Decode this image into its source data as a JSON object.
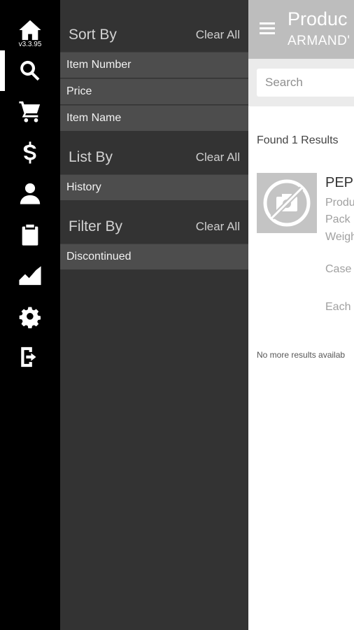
{
  "app": {
    "version": "v3.3.95"
  },
  "rail": {
    "items": [
      {
        "icon": "home-icon",
        "active": false
      },
      {
        "icon": "search-icon",
        "active": true
      },
      {
        "icon": "cart-icon",
        "active": false
      },
      {
        "icon": "dollar-icon",
        "active": false
      },
      {
        "icon": "user-icon",
        "active": false
      },
      {
        "icon": "clipboard-icon",
        "active": false
      },
      {
        "icon": "chart-icon",
        "active": false
      },
      {
        "icon": "gear-icon",
        "active": false
      },
      {
        "icon": "logout-icon",
        "active": false
      }
    ]
  },
  "panel": {
    "sort": {
      "title": "Sort By",
      "clear": "Clear All",
      "options": [
        "Item Number",
        "Price",
        "Item Name"
      ]
    },
    "list": {
      "title": "List By",
      "clear": "Clear All",
      "options": [
        "History"
      ]
    },
    "filter": {
      "title": "Filter By",
      "clear": "Clear All",
      "options": [
        "Discontinued"
      ]
    }
  },
  "main": {
    "title": "Produc",
    "subtitle": "ARMAND'",
    "search_placeholder": "Search",
    "results_count": "Found 1 Results",
    "product": {
      "name": "PEP",
      "line1": "Produ",
      "line2": "Pack",
      "line3": "Weigh",
      "case_label": "Case",
      "each_label": "Each"
    },
    "no_more": "No more results availab"
  },
  "colors": {
    "rail_bg": "#000000",
    "panel_bg": "#333333",
    "option_bg": "#4d4d4d",
    "topbar_bg": "#bdbdbd"
  }
}
